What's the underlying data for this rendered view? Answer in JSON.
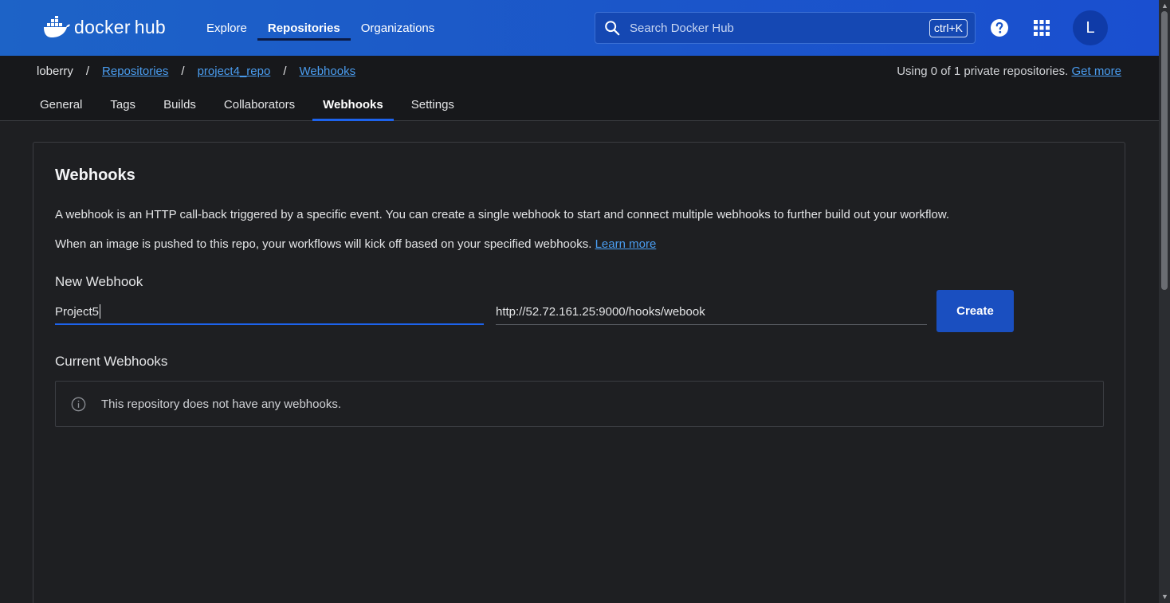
{
  "header": {
    "brand_docker": "docker",
    "brand_hub": "hub",
    "nav": [
      {
        "label": "Explore"
      },
      {
        "label": "Repositories"
      },
      {
        "label": "Organizations"
      }
    ],
    "search_placeholder": "Search Docker Hub",
    "search_shortcut": "ctrl+K",
    "avatar_initial": "L",
    "accent_color": "#1d63ed"
  },
  "breadcrumb": {
    "items": [
      "loberry",
      "Repositories",
      "project4_repo",
      "Webhooks"
    ],
    "separator": "/",
    "usage_text": "Using 0 of 1 private repositories.",
    "usage_link": "Get more"
  },
  "tabs": [
    {
      "label": "General"
    },
    {
      "label": "Tags"
    },
    {
      "label": "Builds"
    },
    {
      "label": "Collaborators"
    },
    {
      "label": "Webhooks"
    },
    {
      "label": "Settings"
    }
  ],
  "webhooks": {
    "title": "Webhooks",
    "description1": "A webhook is an HTTP call-back triggered by a specific event. You can create a single webhook to start and connect multiple webhooks to further build out your workflow.",
    "description2": "When an image is pushed to this repo, your workflows will kick off based on your specified webhooks.",
    "learn_more": "Learn more",
    "new_heading": "New Webhook",
    "name_value": "Project5",
    "url_value": "http://52.72.161.25:9000/hooks/webook",
    "create_label": "Create",
    "current_heading": "Current Webhooks",
    "empty_text": "This repository does not have any webhooks."
  }
}
